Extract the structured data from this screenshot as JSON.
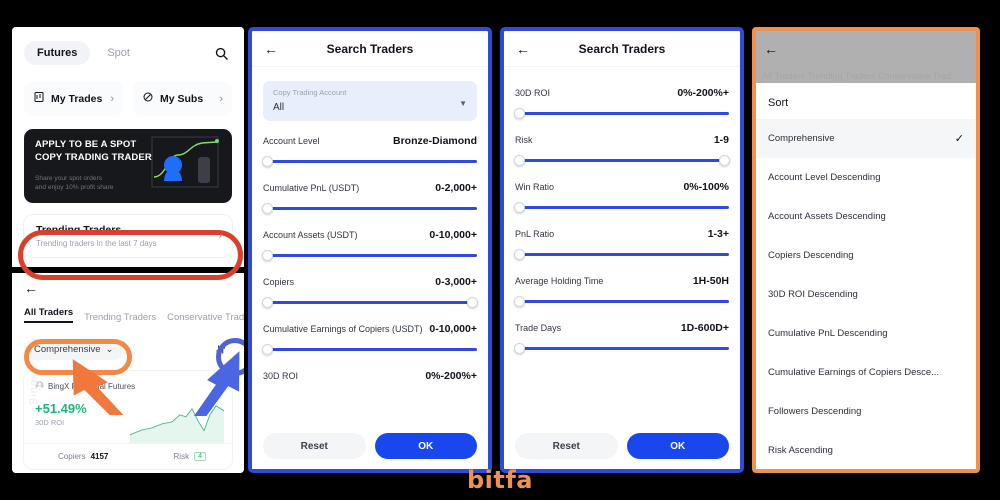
{
  "brand": {
    "name": "bitfa",
    "accent_orange": "#f0924e",
    "accent_blue": "#2f4bdb",
    "accent_red": "#d9402c"
  },
  "panel1": {
    "segments": [
      {
        "label": "Futures",
        "active": true
      },
      {
        "label": "Spot",
        "active": false
      }
    ],
    "search_icon": "search-icon",
    "quick_links": [
      {
        "label": "My Trades",
        "icon": "document-icon"
      },
      {
        "label": "My Subs",
        "icon": "circle-slash-icon"
      }
    ],
    "banner": {
      "title_line1": "APPLY TO BE A SPOT",
      "title_line2": "COPY TRADING TRADER",
      "subtitle_line1": "Share your spot orders",
      "subtitle_line2": "and enjoy 10% profit share"
    },
    "trending_card": {
      "title": "Trending Traders",
      "subtitle": "Trending traders in the last 7 days"
    },
    "tabs": [
      {
        "label": "All Traders",
        "active": true
      },
      {
        "label": "Trending Traders",
        "active": false
      },
      {
        "label": "Conservative Trader",
        "active": false
      }
    ],
    "sort_button": "Comprehensive",
    "filter_icon": "sort-filter-icon",
    "trader_card": {
      "name": "BingX Perpetual Futures",
      "roi": "+51.49%",
      "roi_label": "30D ROI",
      "copiers_label": "Copiers",
      "copiers_value": "4157",
      "risk_label": "Risk",
      "risk_value": "4",
      "watermark": "Bingx"
    }
  },
  "panel2": {
    "title": "Search Traders",
    "account_box": {
      "label": "Copy Trading Account",
      "value": "All"
    },
    "filters": [
      {
        "name": "Account Level",
        "value": "Bronze-Diamond",
        "right_knob": false
      },
      {
        "name": "Cumulative PnL (USDT)",
        "value": "0-2,000+",
        "right_knob": false
      },
      {
        "name": "Account Assets (USDT)",
        "value": "0-10,000+",
        "right_knob": false
      },
      {
        "name": "Copiers",
        "value": "0-3,000+",
        "right_knob": true
      },
      {
        "name": "Cumulative Earnings of Copiers (USDT)",
        "value": "0-10,000+",
        "right_knob": false
      },
      {
        "name": "30D ROI",
        "value": "0%-200%+",
        "right_knob": false
      }
    ],
    "reset_label": "Reset",
    "ok_label": "OK"
  },
  "panel3": {
    "title": "Search Traders",
    "filters": [
      {
        "name": "30D ROI",
        "value": "0%-200%+",
        "right_knob": false
      },
      {
        "name": "Risk",
        "value": "1-9",
        "right_knob": true
      },
      {
        "name": "Win Ratio",
        "value": "0%-100%",
        "right_knob": false
      },
      {
        "name": "PnL Ratio",
        "value": "1-3+",
        "right_knob": false
      },
      {
        "name": "Average Holding Time",
        "value": "1H-50H",
        "right_knob": false
      },
      {
        "name": "Trade Days",
        "value": "1D-600D+",
        "right_knob": false
      }
    ],
    "reset_label": "Reset",
    "ok_label": "OK"
  },
  "panel4": {
    "dim_ghost_text": "All Traders  Trending Traders  Conservative Trad",
    "sheet_title": "Sort",
    "options": [
      {
        "label": "Comprehensive",
        "selected": true
      },
      {
        "label": "Account Level Descending",
        "selected": false
      },
      {
        "label": "Account Assets Descending",
        "selected": false
      },
      {
        "label": "Copiers Descending",
        "selected": false
      },
      {
        "label": "30D ROI Descending",
        "selected": false
      },
      {
        "label": "Cumulative PnL Descending",
        "selected": false
      },
      {
        "label": "Cumulative Earnings of Copiers Desce...",
        "selected": false
      },
      {
        "label": "Followers Descending",
        "selected": false
      },
      {
        "label": "Risk Ascending",
        "selected": false
      }
    ]
  }
}
